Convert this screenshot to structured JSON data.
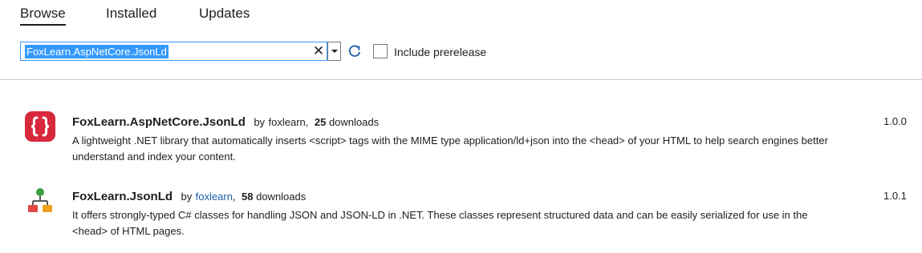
{
  "tabs": [
    {
      "label": "Browse",
      "selected": true
    },
    {
      "label": "Installed",
      "selected": false
    },
    {
      "label": "Updates",
      "selected": false
    }
  ],
  "search": {
    "value": "FoxLearn.AspNetCore.JsonLd",
    "clear_glyph": "✕",
    "include_prerelease_label": "Include prerelease",
    "include_prerelease_checked": false
  },
  "colors": {
    "selection": "#3399ff",
    "link": "#1a5ea8",
    "icon_red": "#d8283c",
    "tree_green": "#3ca03c",
    "tree_red": "#e04848",
    "tree_orange": "#f0a020"
  },
  "packages": [
    {
      "icon": "json-braces-icon",
      "name": "FoxLearn.AspNetCore.JsonLd",
      "by": "by",
      "author": "foxlearn",
      "separator": ",",
      "downloads_count": "25",
      "downloads_label": "downloads",
      "description": "A lightweight .NET library that automatically inserts <script> tags with the MIME type application/ld+json into the <head> of your HTML to help search engines better understand and index your content.",
      "version": "1.0.0"
    },
    {
      "icon": "hierarchy-tree-icon",
      "name": "FoxLearn.JsonLd",
      "by": "by",
      "author": "foxlearn",
      "separator": ",",
      "downloads_count": "58",
      "downloads_label": "downloads",
      "description": "It offers strongly-typed C# classes for handling JSON and JSON-LD in .NET. These classes represent structured data and can be easily serialized for use in the <head> of HTML pages.",
      "version": "1.0.1"
    }
  ]
}
